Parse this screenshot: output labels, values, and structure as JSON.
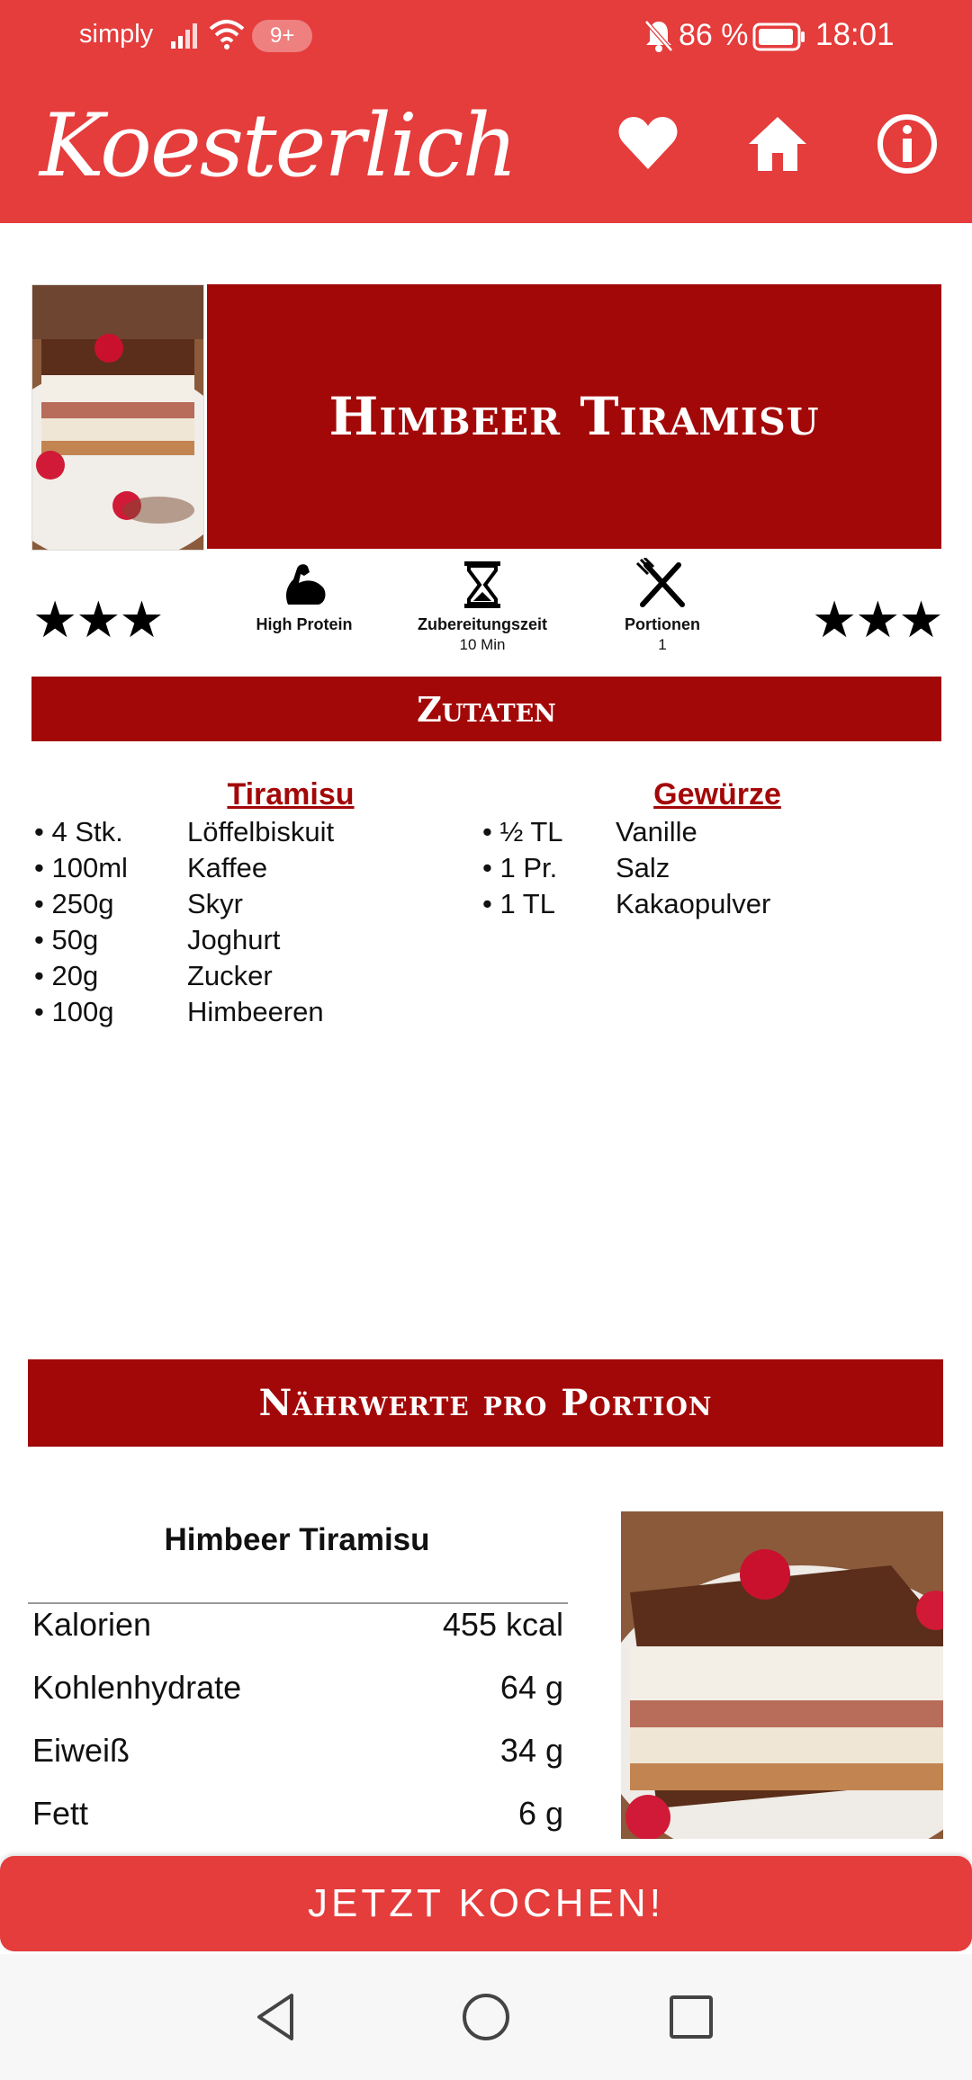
{
  "status_bar": {
    "carrier": "simply",
    "notification_badge": "9+",
    "battery_percent": "86 %",
    "time": "18:01"
  },
  "app_bar": {
    "logo_text": "Koesterlich",
    "icons": [
      "heart-icon",
      "home-icon",
      "info-icon"
    ]
  },
  "recipe": {
    "title": "Himbeer Tiramisu",
    "rating_left": "★★★",
    "rating_right": "★★★",
    "badges": [
      {
        "icon": "muscle-icon",
        "label": "High Protein",
        "sub": ""
      },
      {
        "icon": "hourglass-icon",
        "label": "Zubereitungszeit",
        "sub": "10 Min"
      },
      {
        "icon": "cutlery-icon",
        "label": "Portionen",
        "sub": "1"
      }
    ]
  },
  "ingredients": {
    "header": "Zutaten",
    "groups": [
      {
        "title": "Tiramisu",
        "items": [
          {
            "amount": "4 Stk.",
            "name": "Löffelbiskuit"
          },
          {
            "amount": "100ml",
            "name": "Kaffee"
          },
          {
            "amount": "250g",
            "name": "Skyr"
          },
          {
            "amount": "50g",
            "name": "Joghurt"
          },
          {
            "amount": "20g",
            "name": "Zucker"
          },
          {
            "amount": "100g",
            "name": "Himbeeren"
          }
        ]
      },
      {
        "title": "Gewürze",
        "items": [
          {
            "amount": "½ TL",
            "name": "Vanille"
          },
          {
            "amount": "1 Pr.",
            "name": "Salz"
          },
          {
            "amount": "1 TL",
            "name": "Kakaopulver"
          }
        ]
      }
    ]
  },
  "nutrition": {
    "header": "Nährwerte pro Portion",
    "title": "Himbeer Tiramisu",
    "rows": [
      {
        "label": "Kalorien",
        "value": "455 kcal"
      },
      {
        "label": "Kohlenhydrate",
        "value": "64 g"
      },
      {
        "label": "Eiweiß",
        "value": "34 g"
      },
      {
        "label": "Fett",
        "value": "6 g"
      }
    ]
  },
  "cta": {
    "label": "JETZT KOCHEN!"
  },
  "colors": {
    "primary": "#e53c3c",
    "dark_red": "#a30808"
  }
}
